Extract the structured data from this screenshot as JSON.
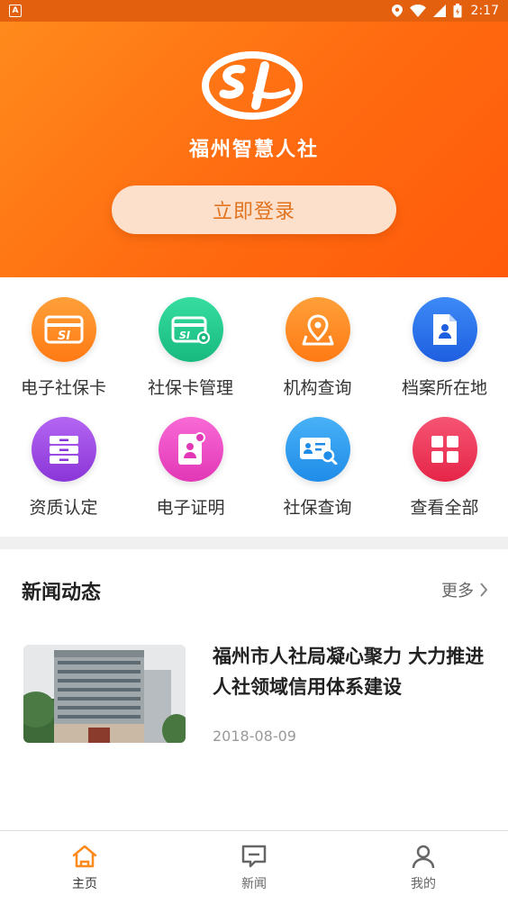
{
  "status_bar": {
    "time": "2:17",
    "app_badge": "A",
    "colors": {
      "bg": "#e2600e"
    }
  },
  "header": {
    "logo_text": "SI",
    "brand_name": "福州智慧人社",
    "login_label": "立即登录",
    "colors": {
      "gradient_start": "#ff8a1c",
      "gradient_end": "#ff5a0a",
      "button_bg": "#fde0cc",
      "button_text": "#e2731f"
    }
  },
  "services": [
    {
      "label": "电子社保卡",
      "icon": "ecard-icon",
      "color": "#ff8a1c"
    },
    {
      "label": "社保卡管理",
      "icon": "card-manage-icon",
      "color": "#22c98c"
    },
    {
      "label": "机构查询",
      "icon": "location-map-icon",
      "color": "#ff8a1c"
    },
    {
      "label": "档案所在地",
      "icon": "archive-icon",
      "color": "#2d73f0"
    },
    {
      "label": "资质认定",
      "icon": "drawer-icon",
      "color": "#a44ae8"
    },
    {
      "label": "电子证明",
      "icon": "certificate-icon",
      "color": "#f04fc4"
    },
    {
      "label": "社保查询",
      "icon": "id-search-icon",
      "color": "#2c9ff0"
    },
    {
      "label": "查看全部",
      "icon": "grid-icon",
      "color": "#f0395a"
    }
  ],
  "news": {
    "section_title": "新闻动态",
    "more_label": "更多",
    "items": [
      {
        "headline": "福州市人社局凝心聚力 大力推进人社领域信用体系建设",
        "date": "2018-08-09",
        "image": "building-photo"
      }
    ]
  },
  "bottom_nav": [
    {
      "label": "主页",
      "icon": "home-icon",
      "active": true
    },
    {
      "label": "新闻",
      "icon": "message-icon",
      "active": false
    },
    {
      "label": "我的",
      "icon": "user-icon",
      "active": false
    }
  ],
  "colors": {
    "accent": "#ff7a14"
  }
}
